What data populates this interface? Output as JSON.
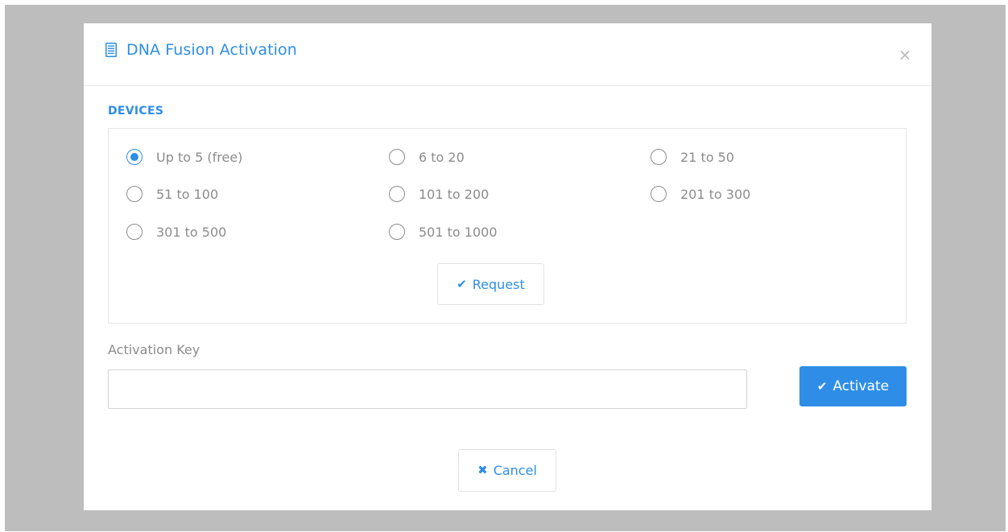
{
  "modal": {
    "title": "DNA Fusion Activation",
    "title_icon": "document-icon",
    "close_glyph": "×",
    "accent_color": "#2e8ee7"
  },
  "devices": {
    "section_label": "DEVICES",
    "options": [
      {
        "label": "Up to 5 (free)",
        "checked": true
      },
      {
        "label": "6 to 20",
        "checked": false
      },
      {
        "label": "21 to 50",
        "checked": false
      },
      {
        "label": "51 to 100",
        "checked": false
      },
      {
        "label": "101 to 200",
        "checked": false
      },
      {
        "label": "201 to 300",
        "checked": false
      },
      {
        "label": "301 to 500",
        "checked": false
      },
      {
        "label": "501 to 1000",
        "checked": false
      }
    ],
    "request_button": {
      "label": "Request",
      "icon": "check-icon",
      "glyph": "✔"
    }
  },
  "activation": {
    "key_label": "Activation Key",
    "key_value": "",
    "activate_button": {
      "label": "Activate",
      "icon": "check-icon",
      "glyph": "✔"
    }
  },
  "cancel_button": {
    "label": "Cancel",
    "icon": "x-icon",
    "glyph": "✖"
  }
}
